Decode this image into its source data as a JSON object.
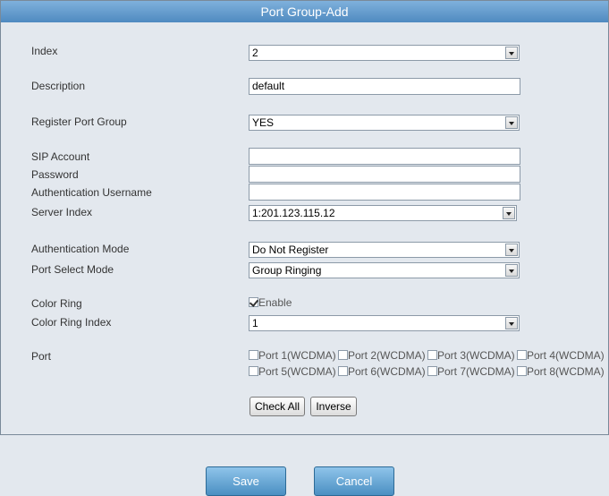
{
  "title": "Port Group-Add",
  "fields": {
    "index": {
      "label": "Index",
      "value": "2"
    },
    "description": {
      "label": "Description",
      "value": "default"
    },
    "register_port_group": {
      "label": "Register Port Group",
      "value": "YES"
    },
    "sip_account": {
      "label": "SIP Account",
      "value": ""
    },
    "password": {
      "label": "Password",
      "value": ""
    },
    "auth_username": {
      "label": "Authentication Username",
      "value": ""
    },
    "server_index": {
      "label": "Server Index",
      "value": "1:201.123.115.12"
    },
    "auth_mode": {
      "label": "Authentication Mode",
      "value": "Do Not Register"
    },
    "port_select_mode": {
      "label": "Port Select Mode",
      "value": "Group Ringing"
    },
    "color_ring": {
      "label": "Color Ring",
      "checkbox_label": "Enable",
      "checked": true
    },
    "color_ring_index": {
      "label": "Color Ring Index",
      "value": "1"
    },
    "port": {
      "label": "Port"
    }
  },
  "ports": [
    {
      "label": "Port 1(WCDMA)",
      "checked": false
    },
    {
      "label": "Port 2(WCDMA)",
      "checked": false
    },
    {
      "label": "Port 3(WCDMA)",
      "checked": false
    },
    {
      "label": "Port 4(WCDMA)",
      "checked": false
    },
    {
      "label": "Port 5(WCDMA)",
      "checked": false
    },
    {
      "label": "Port 6(WCDMA)",
      "checked": false
    },
    {
      "label": "Port 7(WCDMA)",
      "checked": false
    },
    {
      "label": "Port 8(WCDMA)",
      "checked": false
    }
  ],
  "buttons": {
    "check_all": "Check All",
    "inverse": "Inverse",
    "save": "Save",
    "cancel": "Cancel"
  }
}
